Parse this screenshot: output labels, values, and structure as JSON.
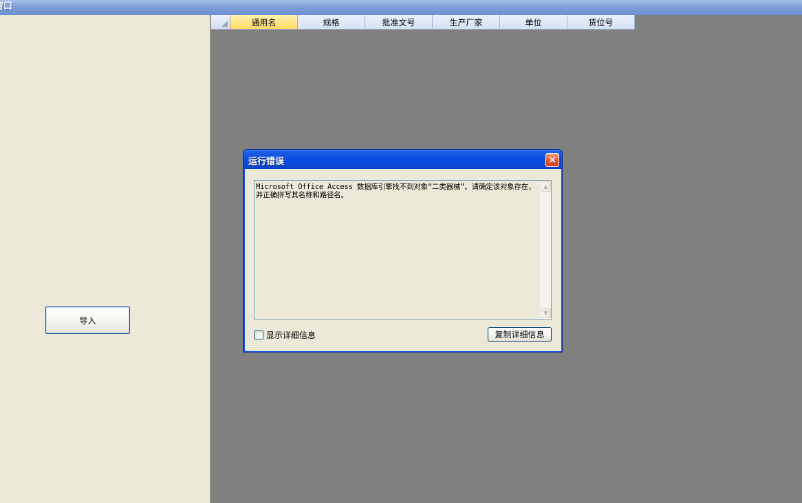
{
  "window": {
    "title": "窗口"
  },
  "left_panel": {
    "import_button_label": "导入"
  },
  "grid": {
    "columns": [
      {
        "label": "通用名",
        "selected": true
      },
      {
        "label": "规格",
        "selected": false
      },
      {
        "label": "批准文号",
        "selected": false
      },
      {
        "label": "生产厂家",
        "selected": false
      },
      {
        "label": "单位",
        "selected": false
      },
      {
        "label": "货位号",
        "selected": false
      }
    ]
  },
  "dialog": {
    "title": "运行错误",
    "close_symbol": "✕",
    "message": "Microsoft Office Access 数据库引擎找不到对象“二类器械”。请确定该对象存在，并正确拼写其名称和路径名。",
    "show_details_label": "显示详细信息",
    "show_details_checked": false,
    "copy_details_button_label": "复制详细信息"
  },
  "colors": {
    "window_title_gradient_top": "#a6c2ec",
    "dialog_title_blue": "#0a4ee0",
    "close_button_red": "#e05a34",
    "selected_column_yellow": "#ffd966",
    "panel_beige": "#ece9d8",
    "background_gray": "#808080"
  },
  "icons": {
    "close": "close-icon",
    "scroll_up": "scroll-up-arrow-icon",
    "scroll_down": "scroll-down-arrow-icon",
    "grid_corner": "select-all-corner-icon"
  }
}
